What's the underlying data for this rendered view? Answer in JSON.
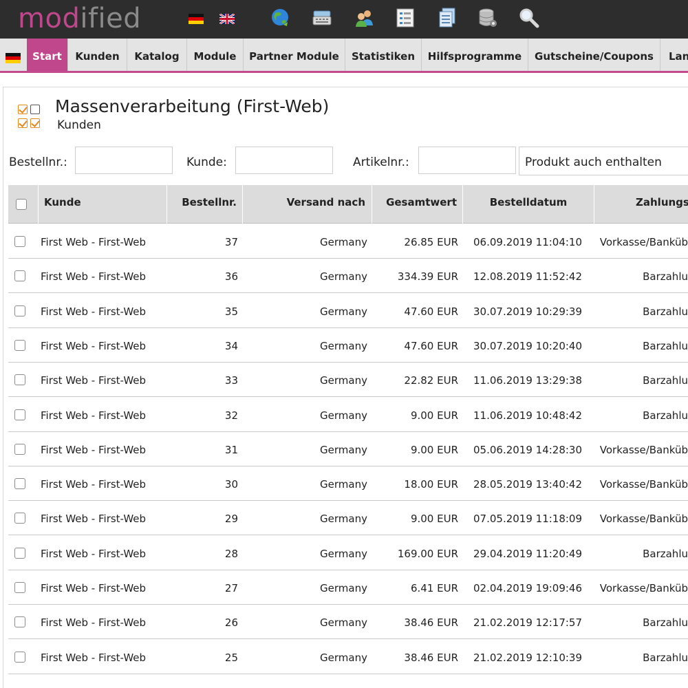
{
  "logo": {
    "part1": "mod",
    "part2": "ified"
  },
  "top_icons": [
    "germany-flag-icon",
    "uk-flag-icon",
    "globe-icon",
    "cash-register-icon",
    "users-icon",
    "list-icon",
    "documents-icon",
    "database-icon",
    "search-icon"
  ],
  "nav": {
    "tabs": [
      "Start",
      "Kunden",
      "Katalog",
      "Module",
      "Partner Module",
      "Statistiken",
      "Hilfsprogramme",
      "Gutscheine/Coupons",
      "Lan"
    ]
  },
  "page": {
    "title": "Massenverarbeitung (First-Web)",
    "subtitle": "Kunden"
  },
  "filters": {
    "bestellnr_label": "Bestellnr.:",
    "kunde_label": "Kunde:",
    "artikelnr_label": "Artikelnr.:",
    "select_value": "Produkt auch enthalten"
  },
  "table": {
    "headers": {
      "kunde": "Kunde",
      "bestellnr": "Bestellnr.",
      "versand": "Versand nach",
      "gesamt": "Gesamtwert",
      "datum": "Bestelldatum",
      "zahlung": "Zahlungsv"
    },
    "rows": [
      {
        "kunde": "First Web - First-Web",
        "nr": "37",
        "versand": "Germany",
        "wert": "26.85 EUR",
        "datum": "06.09.2019 11:04:10",
        "zahlung": "Vorkasse/Banküb"
      },
      {
        "kunde": "First Web - First-Web",
        "nr": "36",
        "versand": "Germany",
        "wert": "334.39 EUR",
        "datum": "12.08.2019 11:52:42",
        "zahlung": "Barzahlu"
      },
      {
        "kunde": "First Web - First-Web",
        "nr": "35",
        "versand": "Germany",
        "wert": "47.60 EUR",
        "datum": "30.07.2019 10:29:39",
        "zahlung": "Barzahlu"
      },
      {
        "kunde": "First Web - First-Web",
        "nr": "34",
        "versand": "Germany",
        "wert": "47.60 EUR",
        "datum": "30.07.2019 10:20:40",
        "zahlung": "Barzahlu"
      },
      {
        "kunde": "First Web - First-Web",
        "nr": "33",
        "versand": "Germany",
        "wert": "22.82 EUR",
        "datum": "11.06.2019 13:29:38",
        "zahlung": "Barzahlu"
      },
      {
        "kunde": "First Web - First-Web",
        "nr": "32",
        "versand": "Germany",
        "wert": "9.00 EUR",
        "datum": "11.06.2019 10:48:42",
        "zahlung": "Barzahlu"
      },
      {
        "kunde": "First Web - First-Web",
        "nr": "31",
        "versand": "Germany",
        "wert": "9.00 EUR",
        "datum": "05.06.2019 14:28:30",
        "zahlung": "Vorkasse/Banküb"
      },
      {
        "kunde": "First Web - First-Web",
        "nr": "30",
        "versand": "Germany",
        "wert": "18.00 EUR",
        "datum": "28.05.2019 13:40:42",
        "zahlung": "Vorkasse/Banküb"
      },
      {
        "kunde": "First Web - First-Web",
        "nr": "29",
        "versand": "Germany",
        "wert": "9.00 EUR",
        "datum": "07.05.2019 11:18:09",
        "zahlung": "Vorkasse/Banküb"
      },
      {
        "kunde": "First Web - First-Web",
        "nr": "28",
        "versand": "Germany",
        "wert": "169.00 EUR",
        "datum": "29.04.2019 11:20:49",
        "zahlung": "Barzahlu"
      },
      {
        "kunde": "First Web - First-Web",
        "nr": "27",
        "versand": "Germany",
        "wert": "6.41 EUR",
        "datum": "02.04.2019 19:09:46",
        "zahlung": "Vorkasse/Banküb"
      },
      {
        "kunde": "First Web - First-Web",
        "nr": "26",
        "versand": "Germany",
        "wert": "38.46 EUR",
        "datum": "21.02.2019 12:17:57",
        "zahlung": "Barzahlu"
      },
      {
        "kunde": "First Web - First-Web",
        "nr": "25",
        "versand": "Germany",
        "wert": "38.46 EUR",
        "datum": "21.02.2019 12:10:39",
        "zahlung": "Barzahlu"
      }
    ]
  },
  "colors": {
    "accent": "#c0478c",
    "header_bg": "#2d2d2d",
    "nav_bg": "#e4e4e4"
  }
}
